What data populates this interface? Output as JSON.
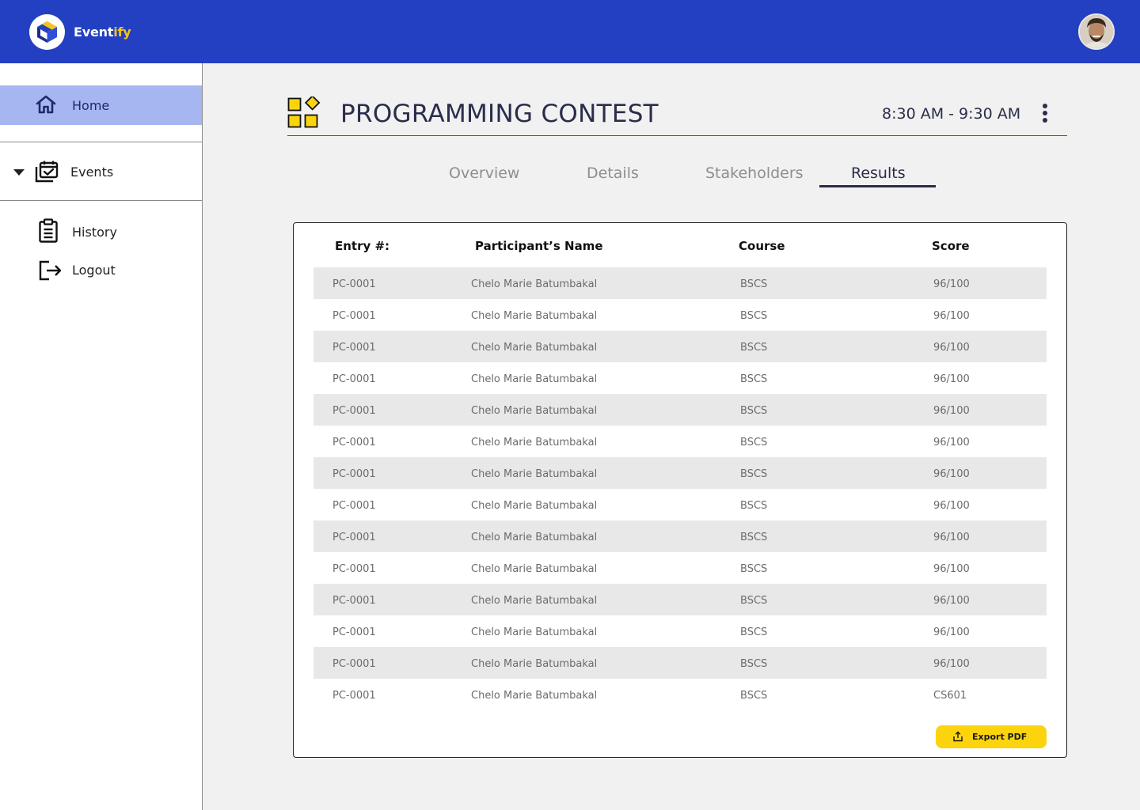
{
  "app": {
    "brand_main": "Event",
    "brand_accent": "ify"
  },
  "sidebar": {
    "home_label": "Home",
    "events_label": "Events",
    "history_label": "History",
    "logout_label": "Logout"
  },
  "event": {
    "title": "PROGRAMMING CONTEST",
    "time": "8:30 AM - 9:30 AM"
  },
  "tabs": [
    {
      "label": "Overview",
      "active": false
    },
    {
      "label": "Details",
      "active": false
    },
    {
      "label": "Stakeholders",
      "active": false
    },
    {
      "label": "Results",
      "active": true
    }
  ],
  "table": {
    "headers": [
      "Entry #:",
      "Participant’s Name",
      "Course",
      "Score"
    ],
    "rows": [
      [
        "PC-0001",
        "Chelo Marie Batumbakal",
        "BSCS",
        "96/100"
      ],
      [
        "PC-0001",
        "Chelo Marie Batumbakal",
        "BSCS",
        "96/100"
      ],
      [
        "PC-0001",
        "Chelo Marie Batumbakal",
        "BSCS",
        "96/100"
      ],
      [
        "PC-0001",
        "Chelo Marie Batumbakal",
        "BSCS",
        "96/100"
      ],
      [
        "PC-0001",
        "Chelo Marie Batumbakal",
        "BSCS",
        "96/100"
      ],
      [
        "PC-0001",
        "Chelo Marie Batumbakal",
        "BSCS",
        "96/100"
      ],
      [
        "PC-0001",
        "Chelo Marie Batumbakal",
        "BSCS",
        "96/100"
      ],
      [
        "PC-0001",
        "Chelo Marie Batumbakal",
        "BSCS",
        "96/100"
      ],
      [
        "PC-0001",
        "Chelo Marie Batumbakal",
        "BSCS",
        "96/100"
      ],
      [
        "PC-0001",
        "Chelo Marie Batumbakal",
        "BSCS",
        "96/100"
      ],
      [
        "PC-0001",
        "Chelo Marie Batumbakal",
        "BSCS",
        "96/100"
      ],
      [
        "PC-0001",
        "Chelo Marie Batumbakal",
        "BSCS",
        "96/100"
      ],
      [
        "PC-0001",
        "Chelo Marie Batumbakal",
        "BSCS",
        "96/100"
      ],
      [
        "PC-0001",
        "Chelo Marie Batumbakal",
        "BSCS",
        "CS601"
      ]
    ]
  },
  "export_label": "Export PDF",
  "colors": {
    "topbar": "#2340c2",
    "brand_accent": "#f5c518",
    "sidebar_active": "#a6b6f1",
    "event_icon": "#fbd40e",
    "export_button": "#fbd40e",
    "row_stripe": "#e8e8e8"
  },
  "icons": {
    "logo": "eventify-cube-logo",
    "home": "home-icon",
    "events": "calendar-check-icon",
    "history": "clipboard-icon",
    "logout": "logout-icon",
    "event": "apps-grid-icon",
    "more": "vertical-dots-icon",
    "export": "upload-share-icon"
  }
}
